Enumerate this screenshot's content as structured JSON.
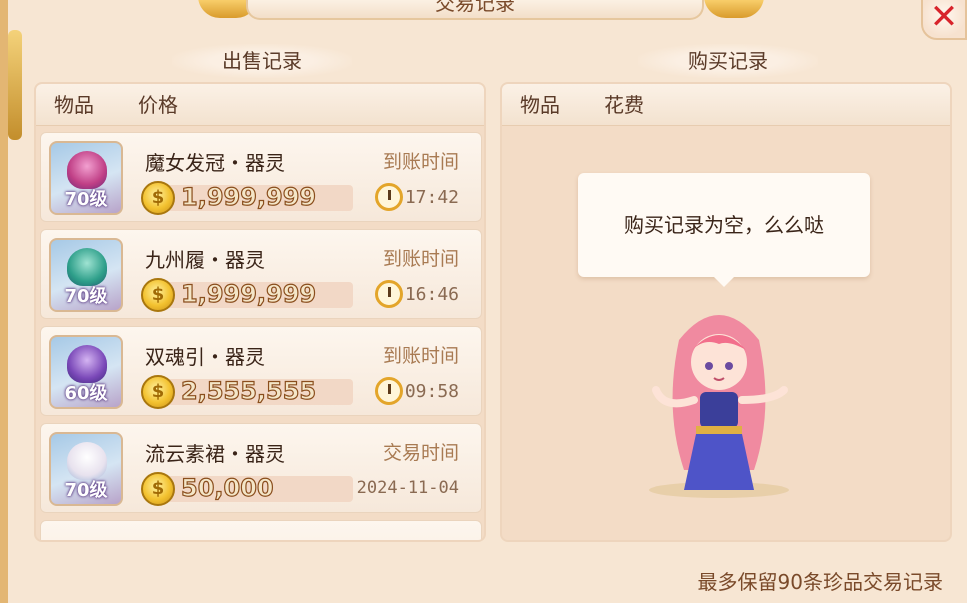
{
  "window": {
    "title": "交易记录",
    "close_icon": "close-icon"
  },
  "sell": {
    "section_title": "出售记录",
    "headers": {
      "item": "物品",
      "price": "价格"
    },
    "rows": [
      {
        "level": "70级",
        "name": "魔女发冠・器灵",
        "price": "1,999,999",
        "time_label": "到账时间",
        "time_value": "17:42",
        "icon": "crown-icon",
        "icon_color": "#c03f86"
      },
      {
        "level": "70级",
        "name": "九州履・器灵",
        "price": "1,999,999",
        "time_label": "到账时间",
        "time_value": "16:46",
        "icon": "boot-icon",
        "icon_color": "#2e9f8a"
      },
      {
        "level": "60级",
        "name": "双魂引・器灵",
        "price": "2,555,555",
        "time_label": "到账时间",
        "time_value": "09:58",
        "icon": "bell-icon",
        "icon_color": "#7a48b8"
      },
      {
        "level": "70级",
        "name": "流云素裙・器灵",
        "price": "50,000",
        "time_label": "交易时间",
        "time_value": "2024-11-04",
        "icon": "skirt-icon",
        "icon_color": "#e8e2ee"
      }
    ]
  },
  "buy": {
    "section_title": "购买记录",
    "headers": {
      "item": "物品",
      "cost": "花费"
    },
    "empty_text": "购买记录为空，么么哒"
  },
  "footer": {
    "note": "最多保留90条珍品交易记录"
  },
  "colors": {
    "accent": "#d8242b",
    "panel": "#f3dcc6",
    "frame": "#e3b673"
  }
}
